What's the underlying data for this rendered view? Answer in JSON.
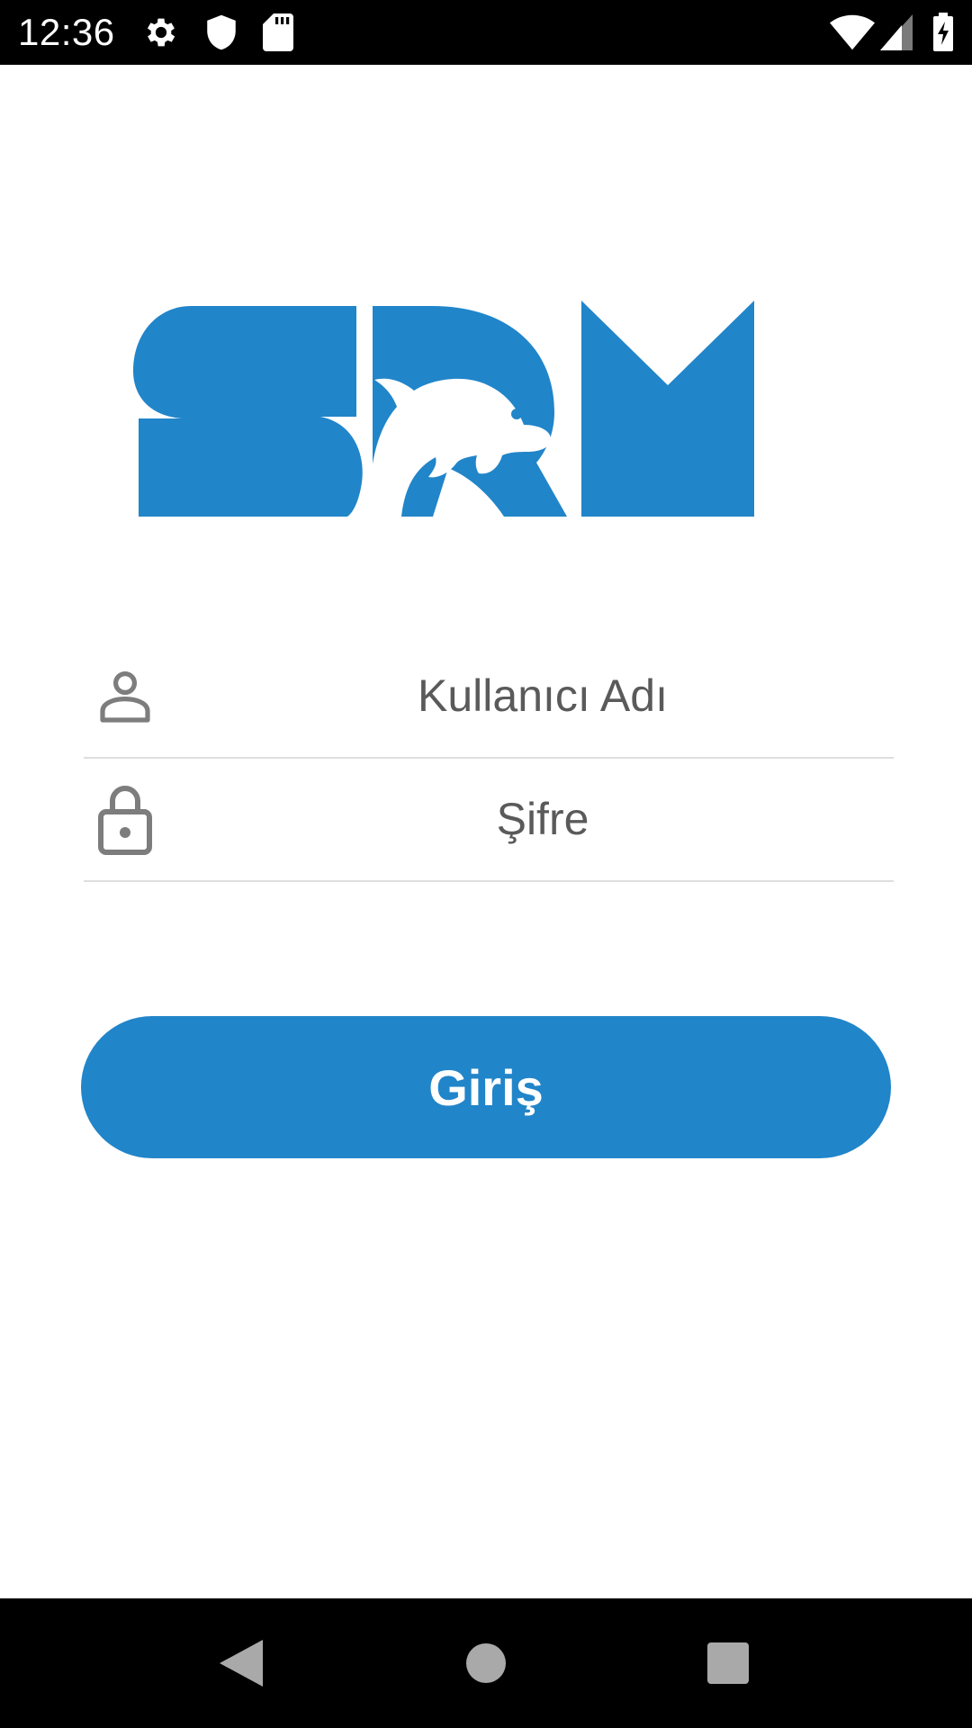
{
  "status_bar": {
    "time": "12:36",
    "left_icons": [
      "gear-icon",
      "shield-icon",
      "sd-card-icon"
    ],
    "right_icons": [
      "wifi-icon",
      "signal-icon",
      "battery-charging-icon"
    ]
  },
  "logo": {
    "text": "SRM",
    "color": "#2185c9"
  },
  "form": {
    "username": {
      "placeholder": "Kullanıcı Adı",
      "value": "",
      "icon": "person-icon"
    },
    "password": {
      "placeholder": "Şifre",
      "value": "",
      "icon": "lock-icon"
    }
  },
  "login_button": {
    "label": "Giriş",
    "color": "#2185c9"
  },
  "nav_bar": {
    "buttons": [
      "back-icon",
      "home-icon",
      "recents-icon"
    ]
  },
  "colors": {
    "accent": "#2185c9",
    "text": "#5a5a5a",
    "divider": "#dedede"
  }
}
